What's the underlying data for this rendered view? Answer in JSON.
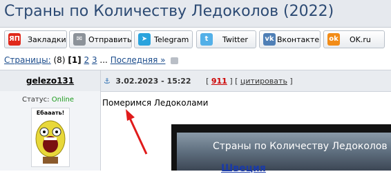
{
  "topic": {
    "title": "Страны по Количеству Ледоколов (2022)"
  },
  "share": {
    "buttons": [
      {
        "label": "Закладки",
        "icon": "ya-icon",
        "icon_text": "ЯП",
        "color": "#e0291b"
      },
      {
        "label": "Отправить",
        "icon": "mail-icon",
        "icon_text": "✉",
        "color": "#8c9299"
      },
      {
        "label": "Telegram",
        "icon": "telegram-icon",
        "icon_text": "➤",
        "color": "#2aa3dd"
      },
      {
        "label": "Twitter",
        "icon": "twitter-icon",
        "icon_text": "t",
        "color": "#53b0e8"
      },
      {
        "label": "Вконтакте",
        "icon": "vk-icon",
        "icon_text": "vk",
        "color": "#4f7fb6"
      },
      {
        "label": "OK.ru",
        "icon": "ok-icon",
        "icon_text": "ok",
        "color": "#f28c18"
      }
    ]
  },
  "pagination": {
    "label": "Страницы:",
    "count": "(8)",
    "current": "[1]",
    "page2": "2",
    "page3": "3",
    "ellipsis": "...",
    "last": "Последняя »"
  },
  "post": {
    "author": "gelezo131",
    "status_label": "Статус:",
    "status_value": "Online",
    "avatar_caption": "Ебааать!",
    "date": "3.02.2023 - 15:22",
    "number": "911",
    "quote_label": "цитировать",
    "text": "Померимся Ледоколами",
    "embed_title": "Страны по Количеству Ледоколов",
    "embed_subtitle": "Швеция"
  }
}
